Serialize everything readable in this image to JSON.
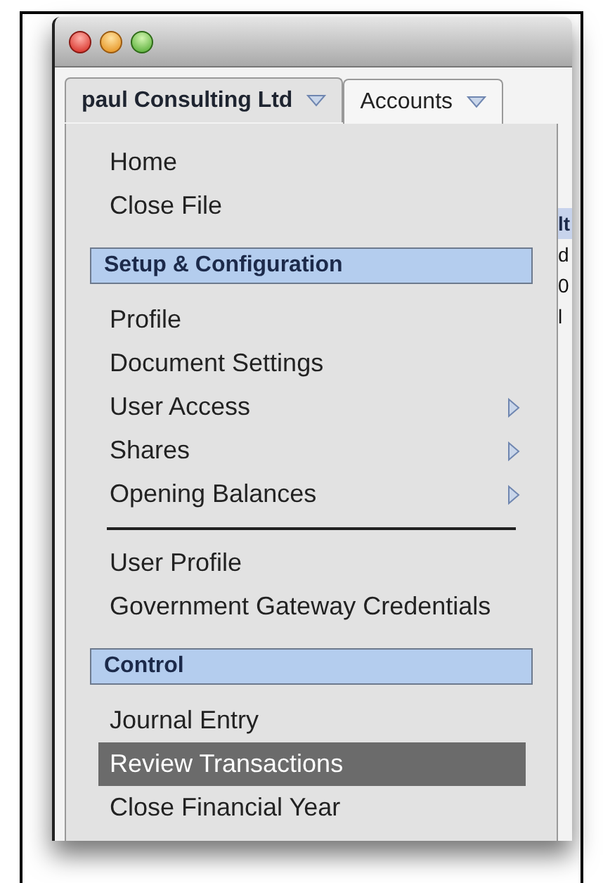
{
  "tabs": [
    {
      "label": "paul Consulting Ltd",
      "selected": true
    },
    {
      "label": "Accounts",
      "selected": false
    }
  ],
  "background_fragments": [
    "lt",
    "d",
    "0",
    "l"
  ],
  "menu": {
    "items": [
      {
        "kind": "item",
        "label": "Home",
        "selected": false,
        "submenu": false
      },
      {
        "kind": "item",
        "label": "Close File",
        "selected": false,
        "submenu": false
      },
      {
        "kind": "header",
        "label": "Setup & Configuration"
      },
      {
        "kind": "item",
        "label": "Profile",
        "selected": false,
        "submenu": false
      },
      {
        "kind": "item",
        "label": "Document Settings",
        "selected": false,
        "submenu": false
      },
      {
        "kind": "item",
        "label": "User Access",
        "selected": false,
        "submenu": true
      },
      {
        "kind": "item",
        "label": "Shares",
        "selected": false,
        "submenu": true
      },
      {
        "kind": "item",
        "label": "Opening Balances",
        "selected": false,
        "submenu": true
      },
      {
        "kind": "separator"
      },
      {
        "kind": "item",
        "label": "User Profile",
        "selected": false,
        "submenu": false
      },
      {
        "kind": "item",
        "label": "Government Gateway Credentials",
        "selected": false,
        "submenu": false
      },
      {
        "kind": "header",
        "label": "Control"
      },
      {
        "kind": "item",
        "label": "Journal Entry",
        "selected": false,
        "submenu": false
      },
      {
        "kind": "item",
        "label": "Review Transactions",
        "selected": true,
        "submenu": false
      },
      {
        "kind": "item",
        "label": "Close Financial Year",
        "selected": false,
        "submenu": false
      }
    ]
  }
}
